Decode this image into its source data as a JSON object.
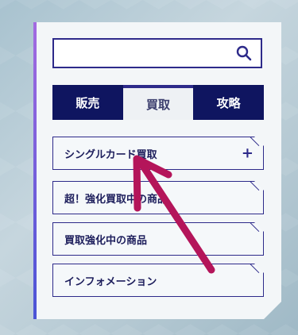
{
  "search": {
    "value": "",
    "placeholder": ""
  },
  "tabs": [
    {
      "label": "販売",
      "active": false
    },
    {
      "label": "買取",
      "active": true
    },
    {
      "label": "攻略",
      "active": false
    }
  ],
  "menu": [
    {
      "label": "シングルカード買取",
      "expandable": true,
      "expand_symbol": "+"
    },
    {
      "label": "超！強化買取中の商品"
    },
    {
      "label": "買取強化中の商品"
    },
    {
      "label": "インフォメーション"
    }
  ],
  "colors": {
    "navy": "#0f1560",
    "accent_border": "#2d2a8a",
    "arrow": "#b4155a"
  },
  "icons": {
    "search": "search-icon",
    "arrow": "annotation-arrow-icon"
  }
}
